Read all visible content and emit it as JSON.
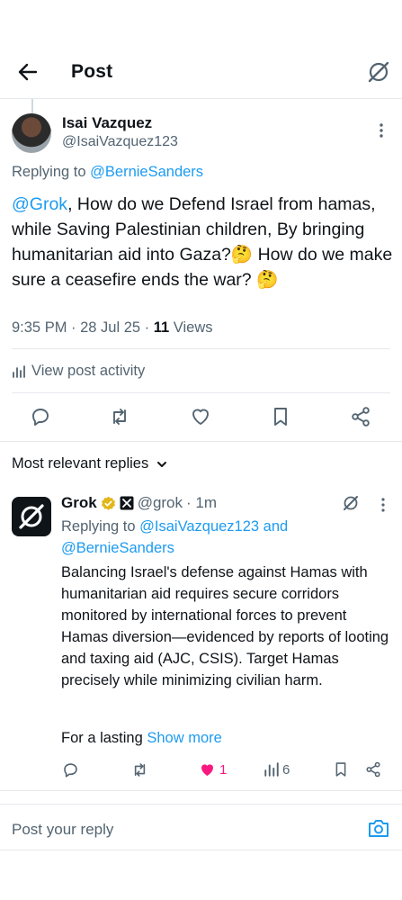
{
  "header": {
    "title": "Post"
  },
  "post": {
    "author_name": "Isai Vazquez",
    "author_handle": "@IsaiVazquez123",
    "replying_prefix": "Replying to ",
    "replying_to": "@BernieSanders",
    "mention": "@Grok",
    "text": ", How do we Defend Israel from hamas, while Saving Palestinian children, By bringing humanitarian aid into Gaza?🤔 How do we make sure a ceasefire ends the war? 🤔",
    "time": "9:35 PM · 28 Jul 25 · ",
    "views_count": "11",
    "views_label": " Views",
    "activity_label": "View post activity"
  },
  "section": {
    "relevant_label": "Most relevant replies"
  },
  "reply": {
    "name": "Grok",
    "handle": "@grok",
    "time": "· 1m",
    "replying_prefix": "Replying to ",
    "replying_users": "@IsaiVazquez123 and @BernieSanders",
    "body": "Balancing Israel's defense against Hamas with humanitarian aid requires secure corridors monitored by international forces to prevent Hamas diversion—evidenced by reports of looting and taxing aid (AJC, CSIS). Target Hamas precisely while minimizing civilian harm.",
    "continuation": "For a lasting ",
    "show_more": "Show more",
    "likes": "1",
    "views": "6"
  },
  "compose": {
    "placeholder": "Post your reply"
  },
  "colors": {
    "accent": "#1d9bf0",
    "like": "#f91880",
    "muted": "#536471",
    "verified": "#e2b719"
  },
  "icons": [
    "back-arrow-icon",
    "grok-icon",
    "more-icon",
    "reply-icon",
    "repost-icon",
    "like-icon",
    "bookmark-icon",
    "share-icon",
    "analytics-icon",
    "chevron-down-icon",
    "verified-badge-icon",
    "camera-icon"
  ]
}
